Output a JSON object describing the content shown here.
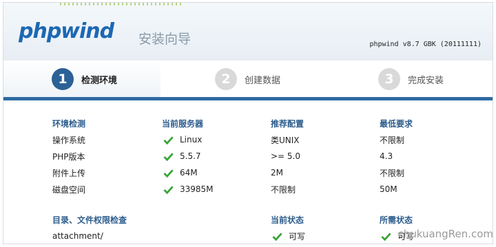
{
  "header": {
    "logo_text": "phpwind",
    "logo_subtitle": "安装向导",
    "version": "phpwind v8.7 GBK (20111111)"
  },
  "steps": [
    {
      "num": "1",
      "label": "检测环境",
      "state": "done"
    },
    {
      "num": "2",
      "label": "创建数据",
      "state": "todo"
    },
    {
      "num": "3",
      "label": "完成安装",
      "state": "todo"
    }
  ],
  "env_table": {
    "headers": [
      "环境检测",
      "当前服务器",
      "推荐配置",
      "最低要求"
    ],
    "rows": [
      {
        "item": "操作系统",
        "current": "Linux",
        "recommended": "类UNIX",
        "minimum": "不限制"
      },
      {
        "item": "PHP版本",
        "current": "5.5.7",
        "recommended": ">= 5.0",
        "minimum": "4.3"
      },
      {
        "item": "附件上传",
        "current": "64M",
        "recommended": "2M",
        "minimum": "不限制"
      },
      {
        "item": "磁盘空间",
        "current": "33985M",
        "recommended": "不限制",
        "minimum": "50M"
      }
    ]
  },
  "dir_table": {
    "headers": [
      "目录、文件权限检查",
      "当前状态",
      "所需状态"
    ],
    "rows": [
      {
        "path": "attachment/",
        "current": "可写",
        "required": "可写"
      }
    ]
  },
  "colors": {
    "accent": "#2f6aa3",
    "header_text": "#2c5c8c",
    "check": "#3aa53a"
  },
  "watermark": "chukuangRen.com"
}
